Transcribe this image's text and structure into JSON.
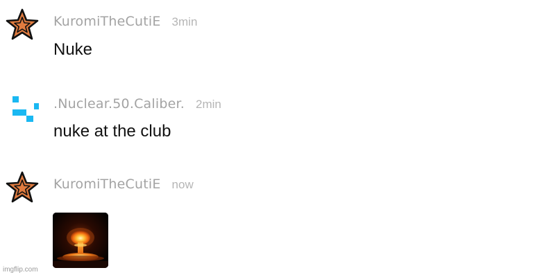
{
  "messages": [
    {
      "username": "KuromiTheCutiE",
      "time": "3min",
      "text": "Nuke",
      "avatar_icon": "star-icon"
    },
    {
      "username": ".Nuclear.50.Caliber.",
      "time": "2min",
      "text": "nuke at the club",
      "avatar_icon": "pixel-squares-icon"
    },
    {
      "username": "KuromiTheCutiE",
      "time": "now",
      "attachment_icon": "mushroom-cloud-icon",
      "avatar_icon": "star-icon"
    }
  ],
  "watermark": "imgflip.com",
  "colors": {
    "username": "#a3a3a3",
    "time": "#b5b5b5",
    "text": "#111111",
    "star_fill": "#e07b3f",
    "pixel_blue": "#1ab8f2"
  }
}
